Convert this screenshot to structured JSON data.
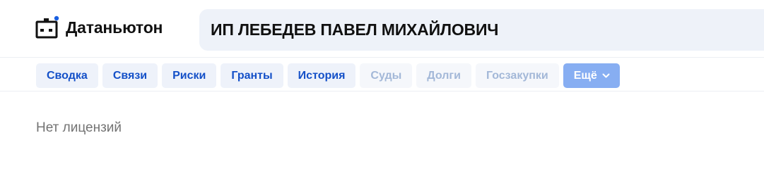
{
  "header": {
    "logo_text": "Датаньютон",
    "search_value": "ИП ЛЕБЕДЕВ ПАВЕЛ МИХАЙЛОВИЧ"
  },
  "tabs": [
    {
      "label": "Сводка",
      "state": "active"
    },
    {
      "label": "Связи",
      "state": "active"
    },
    {
      "label": "Риски",
      "state": "active"
    },
    {
      "label": "Гранты",
      "state": "active"
    },
    {
      "label": "История",
      "state": "active"
    },
    {
      "label": "Суды",
      "state": "disabled"
    },
    {
      "label": "Долги",
      "state": "disabled"
    },
    {
      "label": "Госзакупки",
      "state": "disabled"
    },
    {
      "label": "Ещё",
      "state": "dropdown"
    }
  ],
  "content": {
    "empty_message": "Нет лицензий"
  },
  "colors": {
    "accent": "#1450c8",
    "tab_bg": "#eef2fa",
    "tab_disabled_text": "#a3b8d8",
    "more_bg": "#87aef2",
    "search_bg": "#eef2f9",
    "logo_dot": "#1a5fe0"
  }
}
